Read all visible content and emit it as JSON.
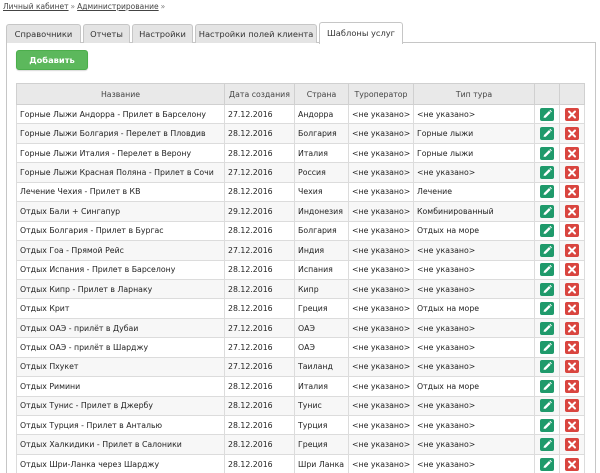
{
  "breadcrumb": {
    "home": "Личный кабинет",
    "admin": "Администрирование",
    "sep": "»"
  },
  "tabs": [
    {
      "label": "Справочники"
    },
    {
      "label": "Отчеты"
    },
    {
      "label": "Настройки"
    },
    {
      "label": "Настройки полей клиента"
    },
    {
      "label": "Шаблоны услуг",
      "active": true
    }
  ],
  "add_button": "Добавить",
  "table": {
    "columns": [
      "Название",
      "Дата создания",
      "Страна",
      "Туроператор",
      "Тип тура",
      "",
      ""
    ],
    "rows": [
      [
        "Горные Лыжи Андорра - Прилет в Барселону",
        "27.12.2016",
        "Андорра",
        "<не указано>",
        "<не указано>"
      ],
      [
        "Горные Лыжи Болгария - Перелет в Пловдив",
        "28.12.2016",
        "Болгария",
        "<не указано>",
        "Горные лыжи"
      ],
      [
        "Горные Лыжи Италия - Перелет в Верону",
        "28.12.2016",
        "Италия",
        "<не указано>",
        "Горные лыжи"
      ],
      [
        "Горные Лыжи Красная Поляна - Прилет в Сочи",
        "27.12.2016",
        "Россия",
        "<не указано>",
        "<не указано>"
      ],
      [
        "Лечение Чехия - Прилет в КВ",
        "28.12.2016",
        "Чехия",
        "<не указано>",
        "Лечение"
      ],
      [
        "Отдых Бали + Сингапур",
        "29.12.2016",
        "Индонезия",
        "<не указано>",
        "Комбинированный"
      ],
      [
        "Отдых Болгария - Прилет в Бургас",
        "28.12.2016",
        "Болгария",
        "<не указано>",
        "Отдых на море"
      ],
      [
        "Отдых Гоа - Прямой Рейс",
        "27.12.2016",
        "Индия",
        "<не указано>",
        "<не указано>"
      ],
      [
        "Отдых Испания - Прилет в Барселону",
        "28.12.2016",
        "Испания",
        "<не указано>",
        "<не указано>"
      ],
      [
        "Отдых Кипр - Прилет в Ларнаку",
        "28.12.2016",
        "Кипр",
        "<не указано>",
        "<не указано>"
      ],
      [
        "Отдых Крит",
        "28.12.2016",
        "Греция",
        "<не указано>",
        "Отдых на море"
      ],
      [
        "Отдых ОАЭ - прилёт в Дубаи",
        "27.12.2016",
        "ОАЭ",
        "<не указано>",
        "<не указано>"
      ],
      [
        "Отдых ОАЭ - прилёт в Шарджу",
        "27.12.2016",
        "ОАЭ",
        "<не указано>",
        "<не указано>"
      ],
      [
        "Отдых Пхукет",
        "27.12.2016",
        "Таиланд",
        "<не указано>",
        "<не указано>"
      ],
      [
        "Отдых Римини",
        "28.12.2016",
        "Италия",
        "<не указано>",
        "Отдых на море"
      ],
      [
        "Отдых Тунис - Прилет в Джербу",
        "28.12.2016",
        "Тунис",
        "<не указано>",
        "<не указано>"
      ],
      [
        "Отдых Турция - Прилет в Анталью",
        "28.12.2016",
        "Турция",
        "<не указано>",
        "<не указано>"
      ],
      [
        "Отдых Халкидики - Прилет в Салоники",
        "28.12.2016",
        "Греция",
        "<не указано>",
        "<не указано>"
      ],
      [
        "Отдых Шри-Ланка через Шарджу",
        "28.12.2016",
        "Шри Ланка",
        "<не указано>",
        "<не указано>"
      ]
    ]
  },
  "icons": {
    "edit": "pencil-icon",
    "delete": "close-icon"
  },
  "colors": {
    "add": "#5cb85c",
    "edit": "#1f9a6b",
    "delete": "#d9453f"
  }
}
